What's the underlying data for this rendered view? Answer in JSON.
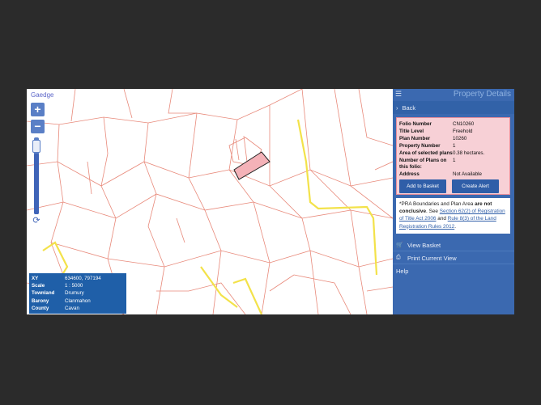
{
  "map": {
    "townland_label": "Gaedge",
    "zoom_in": "+",
    "zoom_out": "−",
    "refresh_icon": "refresh-icon",
    "info": {
      "rows": [
        {
          "k": "XY",
          "v": "634600, 797194"
        },
        {
          "k": "Scale",
          "v": "1 : 5000"
        },
        {
          "k": "Townland",
          "v": "Drumury"
        },
        {
          "k": "Barony",
          "v": "Clanmahon"
        },
        {
          "k": "County",
          "v": "Cavan"
        }
      ]
    },
    "colors": {
      "boundary": "#e8897a",
      "road": "#f3e24a",
      "selected": "#f4b2b8"
    }
  },
  "panel": {
    "title": "Property Details",
    "menu_icon": "menu-icon",
    "back_label": "Back",
    "details": {
      "rows": [
        {
          "k": "Folio Number",
          "v": "CN10260"
        },
        {
          "k": "Title Level",
          "v": "Freehold"
        },
        {
          "k": "Plan Number",
          "v": "10260"
        },
        {
          "k": "Property Number",
          "v": "1"
        },
        {
          "k": "Area of selected plans",
          "v": "0.38 hectares."
        },
        {
          "k": "Number of Plans on this folio:",
          "v": "1"
        },
        {
          "k": "Address",
          "v": "Not Available"
        }
      ],
      "add_basket": "Add to Basket",
      "create_alert": "Create Alert"
    },
    "notice": {
      "prefix": "*PRA Boundaries and Plan Area ",
      "bold": "are not conclusive",
      "mid": ". See ",
      "link1": "Section 62(2) of Registration of Title Act 2006",
      "and": " and ",
      "link2": "Rule 8(3) of the Land Registration Rules 2012",
      "end": "."
    },
    "links": {
      "view_basket": "View Basket",
      "print_view": "Print Current View",
      "help": "Help"
    }
  }
}
